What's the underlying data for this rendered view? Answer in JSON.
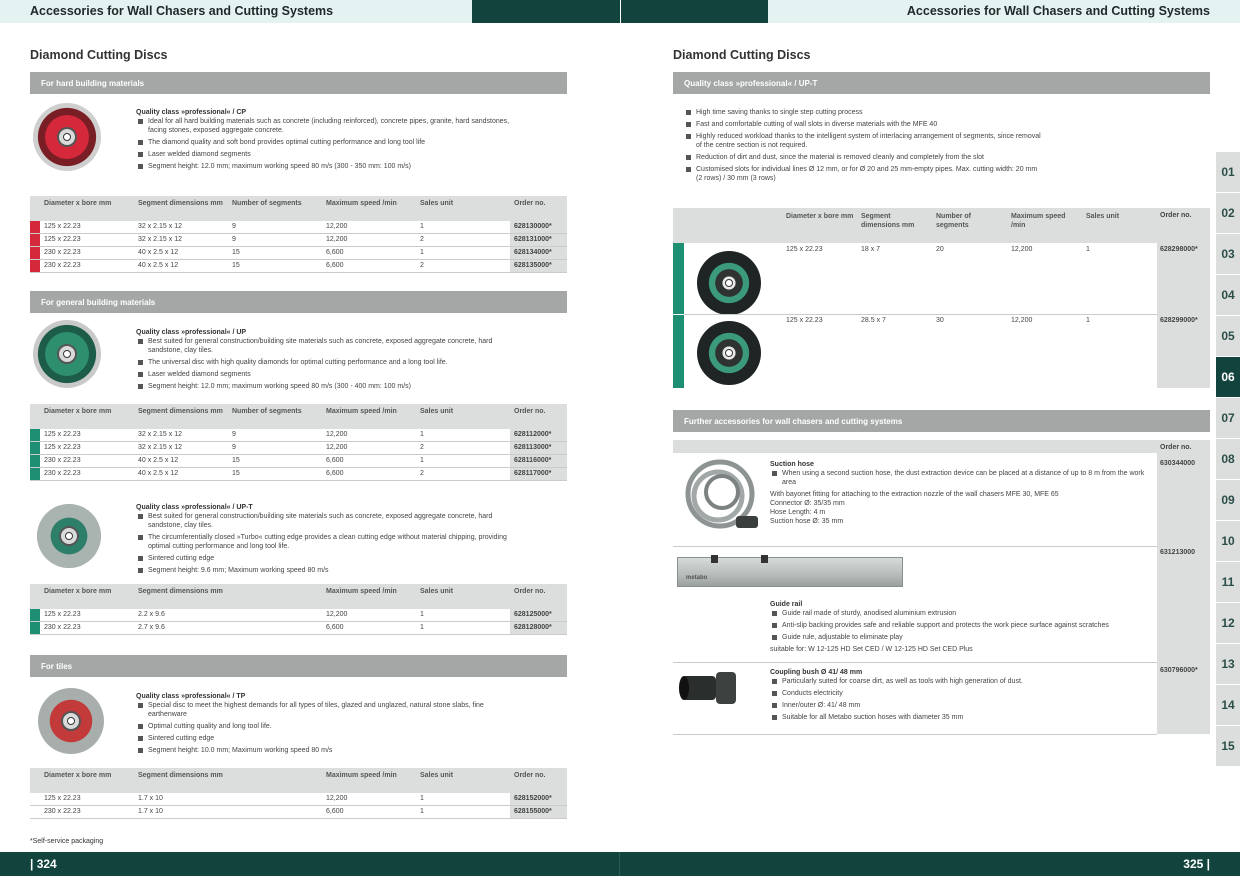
{
  "header": {
    "left_title": "Accessories for Wall Chasers and Cutting Systems",
    "right_title": "Accessories for Wall Chasers and Cutting Systems"
  },
  "footer": {
    "left_page": "| 324",
    "right_page": "325 |"
  },
  "footnote": "*Self-service packaging",
  "colors": {
    "dark_teal": "#12443d",
    "light_teal": "#e4f2f1",
    "band_grey": "#a4a7a6",
    "marker_red": "#d5283b",
    "marker_green": "#1f8f74"
  },
  "tabs": [
    "01",
    "02",
    "03",
    "04",
    "05",
    "06",
    "07",
    "08",
    "09",
    "10",
    "11",
    "12",
    "13",
    "14",
    "15"
  ],
  "active_tab": "06",
  "left": {
    "heading": "Diamond Cutting Discs",
    "sections": [
      {
        "band": "For hard building materials",
        "quality": "Quality class »professional« / CP",
        "bullets": [
          "Ideal for all hard building materials such as concrete (including reinforced), concrete pipes, granite, hard sandstones, facing stones, exposed aggregate concrete.",
          "The diamond quality and soft bond provides optimal cutting performance and long tool life",
          "Laser welded diamond segments",
          "Segment height: 12.0 mm; maximum working speed 80 m/s (300 - 350 mm: 100 m/s)"
        ],
        "headers": [
          "Diameter x bore mm",
          "Segment dimensions mm",
          "Number of segments",
          "Maximum speed /min",
          "Sales unit",
          "Order no."
        ],
        "rows": [
          [
            "125 x 22.23",
            "32 x 2.15 x 12",
            "9",
            "12,200",
            "1",
            "628130000*"
          ],
          [
            "125 x 22.23",
            "32 x 2.15 x 12",
            "9",
            "12,200",
            "2",
            "628131000*"
          ],
          [
            "230 x 22.23",
            "40 x 2.5 x 12",
            "15",
            "6,600",
            "1",
            "628134000*"
          ],
          [
            "230 x 22.23",
            "40 x 2.5 x 12",
            "15",
            "6,600",
            "2",
            "628135000*"
          ]
        ]
      },
      {
        "band": "For general building materials",
        "quality": "Quality class »professional« / UP",
        "bullets": [
          "Best suited for general construction/building site materials such as concrete, exposed aggregate concrete, hard sandstone, clay tiles.",
          "The universal disc with high quality diamonds for optimal cutting performance and a long tool life.",
          "Laser welded diamond segments",
          "Segment height: 12.0 mm; maximum working speed 80 m/s (300 - 400 mm: 100 m/s)"
        ],
        "headers": [
          "Diameter x bore mm",
          "Segment dimensions mm",
          "Number of segments",
          "Maximum speed /min",
          "Sales unit",
          "Order no."
        ],
        "rows": [
          [
            "125 x 22.23",
            "32 x 2.15 x 12",
            "9",
            "12,200",
            "1",
            "628112000*"
          ],
          [
            "125 x 22.23",
            "32 x 2.15 x 12",
            "9",
            "12,200",
            "2",
            "628113000*"
          ],
          [
            "230 x 22.23",
            "40 x 2.5 x 12",
            "15",
            "6,600",
            "1",
            "628116000*"
          ],
          [
            "230 x 22.23",
            "40 x 2.5 x 12",
            "15",
            "6,600",
            "2",
            "628117000*"
          ]
        ]
      },
      {
        "band": "",
        "quality": "Quality class »professional« / UP-T",
        "bullets": [
          "Best suited for general construction/building site materials such as concrete, exposed aggregate concrete, hard sandstone, clay tiles.",
          "The circumferentially closed »Turbo« cutting edge provides a clean cutting edge without material chipping, providing optimal cutting performance and long tool life.",
          "Sintered cutting edge",
          "Segment height: 9.6 mm; Maximum working speed 80 m/s"
        ],
        "headers": [
          "Diameter x bore mm",
          "Segment dimensions mm",
          "",
          "Maximum speed /min",
          "Sales unit",
          "Order no."
        ],
        "rows": [
          [
            "125 x 22.23",
            "2.2 x 9.6",
            "",
            "12,200",
            "1",
            "628125000*"
          ],
          [
            "230 x 22.23",
            "2.7 x 9.6",
            "",
            "6,600",
            "1",
            "628128000*"
          ]
        ]
      },
      {
        "band": "For tiles",
        "quality": "Quality class »professional« / TP",
        "bullets": [
          "Special disc to meet the highest demands for all types of tiles, glazed and unglazed, natural stone slabs, fine earthenware",
          "Optimal cutting quality and long tool life.",
          "Sintered cutting edge",
          "Segment height: 10.0 mm; Maximum working speed 80 m/s"
        ],
        "headers": [
          "Diameter x bore mm",
          "Segment dimensions mm",
          "",
          "Maximum speed /min",
          "Sales unit",
          "Order no."
        ],
        "rows": [
          [
            "125 x 22.23",
            "1.7 x 10",
            "",
            "12,200",
            "1",
            "628152000*"
          ],
          [
            "230 x 22.23",
            "1.7 x 10",
            "",
            "6,600",
            "1",
            "628155000*"
          ]
        ]
      }
    ]
  },
  "right": {
    "heading": "Diamond Cutting Discs",
    "band": "Quality class »professional« / UP-T",
    "bullets": [
      "High time saving thanks to single step cutting process",
      "Fast and comfortable cutting of wall slots in diverse materials with the MFE 40",
      "Highly reduced workload thanks to the intelligent system of interlacing arrangement of segments, since removal of the centre section is not required.",
      "Reduction of dirt and dust, since the material is removed cleanly and completely from the slot",
      "Customised slots for individual lines Ø 12 mm, or for Ø 20 and 25 mm-empty pipes. Max. cutting width: 20 mm (2 rows) / 30 mm (3 rows)"
    ],
    "headers": [
      "Diameter x bore mm",
      "Segment dimensions mm",
      "Number of segments",
      "Maximum speed /min",
      "Sales unit",
      "Order no."
    ],
    "rows": [
      [
        "125 x 22.23",
        "18 x 7",
        "20",
        "12,200",
        "1",
        "628298000*"
      ],
      [
        "125 x 22.23",
        "28.5 x 7",
        "30",
        "12,200",
        "1",
        "628299000*"
      ]
    ],
    "further_band": "Further accessories for wall chasers and cutting systems",
    "order_header": "Order no.",
    "accessories": [
      {
        "title": "Suction hose",
        "bullets": [
          "When using a second suction hose, the dust extraction device can be placed at a distance of up to 8 m from the work area"
        ],
        "lines": [
          "With bayonet fitting for attaching to the extraction nozzle of the wall chasers MFE 30, MFE 65",
          "Connector Ø: 35/35 mm",
          "Hose Length: 4 m",
          "Suction hose Ø: 35 mm"
        ],
        "order": "630344000"
      },
      {
        "title": "Guide rail",
        "bullets": [
          "Guide rail made of sturdy, anodised aluminium extrusion",
          "Anti-slip backing provides safe and reliable support and protects the work piece surface against scratches",
          "Guide rule, adjustable to eliminate play"
        ],
        "lines": [
          "suitable for: W 12-125 HD Set CED / W 12-125 HD Set CED Plus"
        ],
        "order": "631213000",
        "rail_brand": "metabo"
      },
      {
        "title": "Coupling bush Ø 41/ 48 mm",
        "bullets": [
          "Particularly suited for coarse dirt, as well as tools with high generation of dust.",
          "Conducts electricity",
          "Inner/outer Ø: 41/ 48 mm",
          "Suitable for all Metabo suction hoses with diameter 35 mm"
        ],
        "lines": [],
        "order": "630796000*"
      }
    ]
  }
}
